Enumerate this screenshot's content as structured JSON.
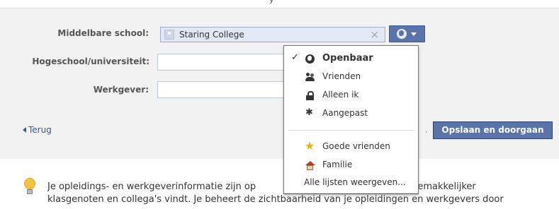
{
  "top_cut_text": "y",
  "form": {
    "high_school_label": "Middelbare school:",
    "high_school_value": "Staring College",
    "university_label": "Hogeschool/universiteit:",
    "university_value": "",
    "employer_label": "Werkgever:",
    "employer_value": ""
  },
  "privacy_button": {
    "icon": "globe-icon"
  },
  "privacy_menu": {
    "items": [
      {
        "label": "Openbaar",
        "icon": "globe-icon",
        "checked": true
      },
      {
        "label": "Vrienden",
        "icon": "friends-icon",
        "checked": false
      },
      {
        "label": "Alleen ik",
        "icon": "lock-icon",
        "checked": false
      },
      {
        "label": "Aangepast",
        "icon": "gear-icon",
        "checked": false
      }
    ],
    "lists": [
      {
        "label": "Goede vrienden",
        "icon": "star-icon"
      },
      {
        "label": "Familie",
        "icon": "house-icon"
      },
      {
        "label": "Alle lijsten weergeven..."
      }
    ]
  },
  "actions": {
    "back_label": "Terug",
    "separator": "·",
    "save_label": "Opslaan en doorgaan"
  },
  "info": {
    "line1": "Je opleidings- en werkgeverinformatie zijn op",
    "line1_end": "t je gemakkelijker",
    "line2": "klasgenoten en collega's vindt. Je beheert de zichtbaarheid van je opleidingen en werkgevers door"
  },
  "colors": {
    "accent": "#3b5998",
    "button_bg": "#5b74a8",
    "panel_bg": "#f2f2f2"
  }
}
